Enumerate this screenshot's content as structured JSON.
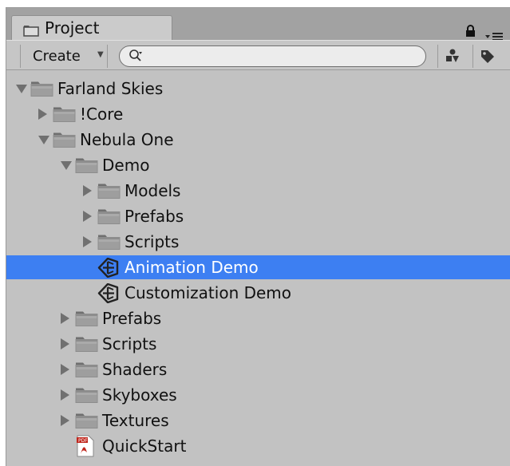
{
  "tab": {
    "title": "Project",
    "icon": "folder-icon"
  },
  "header_icons": {
    "lock": "lock-icon",
    "menu": "menu-icon"
  },
  "toolbar": {
    "create_label": "Create",
    "create_caret": "▼",
    "search_placeholder": "",
    "filter_type_icon": "filter-by-type-icon",
    "filter_label_icon": "filter-by-label-icon"
  },
  "tree": [
    {
      "label": "Farland Skies",
      "depth": 0,
      "type": "folder",
      "expand": "open"
    },
    {
      "label": "!Core",
      "depth": 1,
      "type": "folder",
      "expand": "closed"
    },
    {
      "label": "Nebula One",
      "depth": 1,
      "type": "folder",
      "expand": "open"
    },
    {
      "label": "Demo",
      "depth": 2,
      "type": "folder",
      "expand": "open"
    },
    {
      "label": "Models",
      "depth": 3,
      "type": "folder",
      "expand": "closed"
    },
    {
      "label": "Prefabs",
      "depth": 3,
      "type": "folder",
      "expand": "closed"
    },
    {
      "label": "Scripts",
      "depth": 3,
      "type": "folder",
      "expand": "closed"
    },
    {
      "label": "Animation Demo",
      "depth": 3,
      "type": "unity-scene",
      "expand": "none",
      "selected": true
    },
    {
      "label": "Customization Demo",
      "depth": 3,
      "type": "unity-scene",
      "expand": "none"
    },
    {
      "label": "Prefabs",
      "depth": 2,
      "type": "folder",
      "expand": "closed"
    },
    {
      "label": "Scripts",
      "depth": 2,
      "type": "folder",
      "expand": "closed"
    },
    {
      "label": "Shaders",
      "depth": 2,
      "type": "folder",
      "expand": "closed"
    },
    {
      "label": "Skyboxes",
      "depth": 2,
      "type": "folder",
      "expand": "closed"
    },
    {
      "label": "Textures",
      "depth": 2,
      "type": "folder",
      "expand": "closed"
    },
    {
      "label": "QuickStart",
      "depth": 2,
      "type": "pdf",
      "expand": "none"
    }
  ],
  "colors": {
    "selection": "#3d7ff2",
    "panel_bg": "#c2c2c2",
    "tab_bar": "#a2a2a2"
  }
}
